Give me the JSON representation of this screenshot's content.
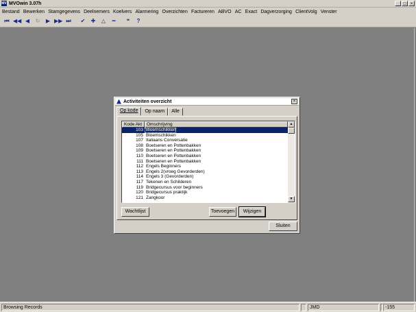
{
  "window": {
    "icon_label": "MV",
    "title": "MVOwin 3.07h",
    "controls": [
      "_",
      "□",
      "×"
    ]
  },
  "menu": [
    "Bestand",
    "Bewerken",
    "Stamgegevens",
    "Deelnemers",
    "Koelvers",
    "Alarmering",
    "Overzichten",
    "Factureren",
    "ABVO",
    "AC",
    "Exact",
    "Dagverzorging",
    "ClientVolg",
    "Venster"
  ],
  "toolbar": {
    "icons": [
      {
        "name": "first-record-icon",
        "glyph": "⏮",
        "enabled": true
      },
      {
        "name": "prev-page-icon",
        "glyph": "◀◀",
        "enabled": true
      },
      {
        "name": "prev-record-icon",
        "glyph": "◀",
        "enabled": true
      },
      {
        "name": "refresh-icon",
        "glyph": "↻",
        "enabled": false
      },
      {
        "name": "next-record-icon",
        "glyph": "▶",
        "enabled": true
      },
      {
        "name": "next-page-icon",
        "glyph": "▶▶",
        "enabled": true
      },
      {
        "name": "last-record-icon",
        "glyph": "⏭",
        "enabled": true
      },
      {
        "name": "check-icon",
        "glyph": "✔",
        "enabled": true
      },
      {
        "name": "plus-icon",
        "glyph": "✚",
        "enabled": true
      },
      {
        "name": "triangle-icon",
        "glyph": "△",
        "enabled": true
      },
      {
        "name": "minus-icon",
        "glyph": "━",
        "enabled": true
      },
      {
        "name": "quote-icon",
        "glyph": "❝",
        "enabled": true
      },
      {
        "name": "help-icon",
        "glyph": "?",
        "enabled": true
      }
    ]
  },
  "dialog": {
    "title": "Activiteiten overzicht",
    "close_label": "×",
    "tabs": [
      "Op kode",
      "Op naam",
      "Alle"
    ],
    "active_tab": 0,
    "columns": {
      "kode": "Kode Akt",
      "omschrijving": "Omschrijving"
    },
    "rows": [
      {
        "kode": "103",
        "omschrijving": "Bloemschikken"
      },
      {
        "kode": "105",
        "omschrijving": "Bloemschikken"
      },
      {
        "kode": "107",
        "omschrijving": "Italiaans Conversatie"
      },
      {
        "kode": "108",
        "omschrijving": "Boetseren en Pottenbakken"
      },
      {
        "kode": "109",
        "omschrijving": "Boetseren en Pottenbakken"
      },
      {
        "kode": "110",
        "omschrijving": "Boetseren en Pottenbakken"
      },
      {
        "kode": "111",
        "omschrijving": "Boetseren en Pottenbakken"
      },
      {
        "kode": "112",
        "omschrijving": "Engels Beginners"
      },
      {
        "kode": "113",
        "omschrijving": "Engels 2(vroeg Gevorderden)"
      },
      {
        "kode": "114",
        "omschrijving": "Engels 3 (Gevorderden)"
      },
      {
        "kode": "117",
        "omschrijving": "Tekenen en Schilderen"
      },
      {
        "kode": "119",
        "omschrijving": "Bridgecursus voor beginners"
      },
      {
        "kode": "120",
        "omschrijving": "Bridgecursus praktijk"
      },
      {
        "kode": "121",
        "omschrijving": "Zangkoor"
      }
    ],
    "selected_row": 0,
    "buttons": {
      "wachtlijst": "Wachtlijst",
      "toevoegen": "Toevoegen",
      "wijzigen": "Wijzigen",
      "sluiten": "Sluiten"
    }
  },
  "statusbar": {
    "message": "Browsing Records",
    "user": "JMD",
    "number": "-155"
  }
}
